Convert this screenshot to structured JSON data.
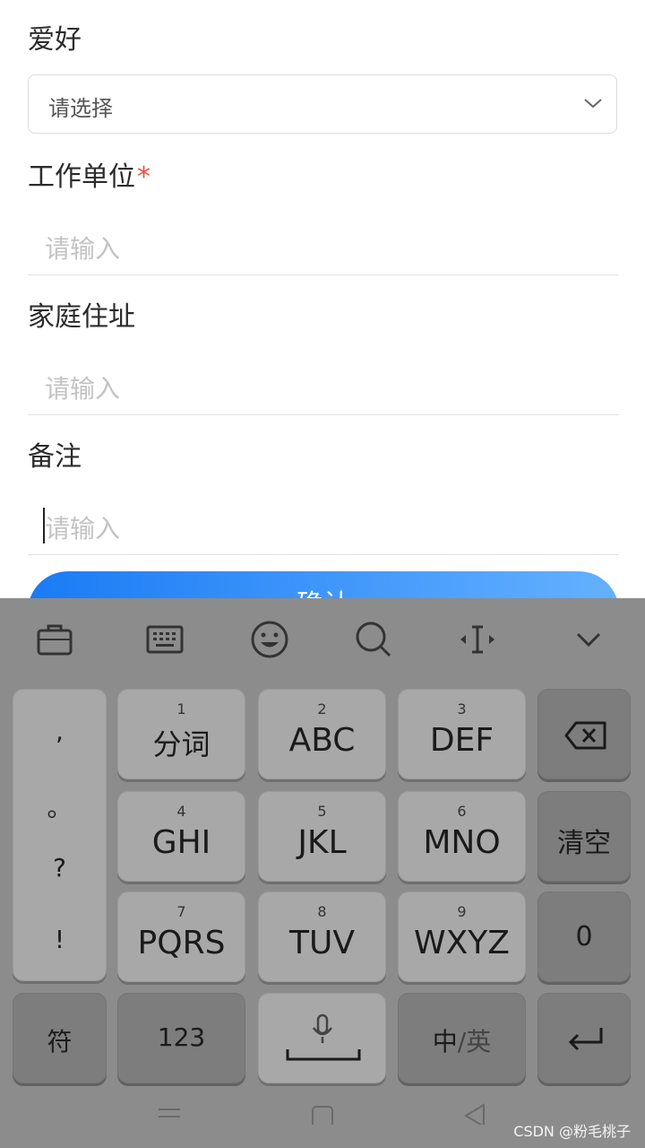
{
  "form": {
    "hobby_label": "爱好",
    "hobby_placeholder": "请选择",
    "work_label": "工作单位",
    "required_mark": "*",
    "work_placeholder": "请输入",
    "address_label": "家庭住址",
    "address_placeholder": "请输入",
    "note_label": "备注",
    "note_placeholder": "请输入",
    "submit_label": "确认"
  },
  "keyboard": {
    "punct": [
      ",",
      "。",
      "?",
      "!"
    ],
    "keys": [
      {
        "num": "1",
        "label": "分词"
      },
      {
        "num": "2",
        "label": "ABC"
      },
      {
        "num": "3",
        "label": "DEF"
      },
      {
        "num": "4",
        "label": "GHI"
      },
      {
        "num": "5",
        "label": "JKL"
      },
      {
        "num": "6",
        "label": "MNO"
      },
      {
        "num": "7",
        "label": "PQRS"
      },
      {
        "num": "8",
        "label": "TUV"
      },
      {
        "num": "9",
        "label": "WXYZ"
      }
    ],
    "clear_label": "清空",
    "zero_label": "0",
    "symbol_label": "符",
    "num123_label": "123",
    "lang_zh": "中",
    "lang_sep": "/",
    "lang_en": "英"
  },
  "watermark": "CSDN @粉毛桃子",
  "colors": {
    "accent": "#1a7bf5",
    "required": "#e8503a"
  }
}
